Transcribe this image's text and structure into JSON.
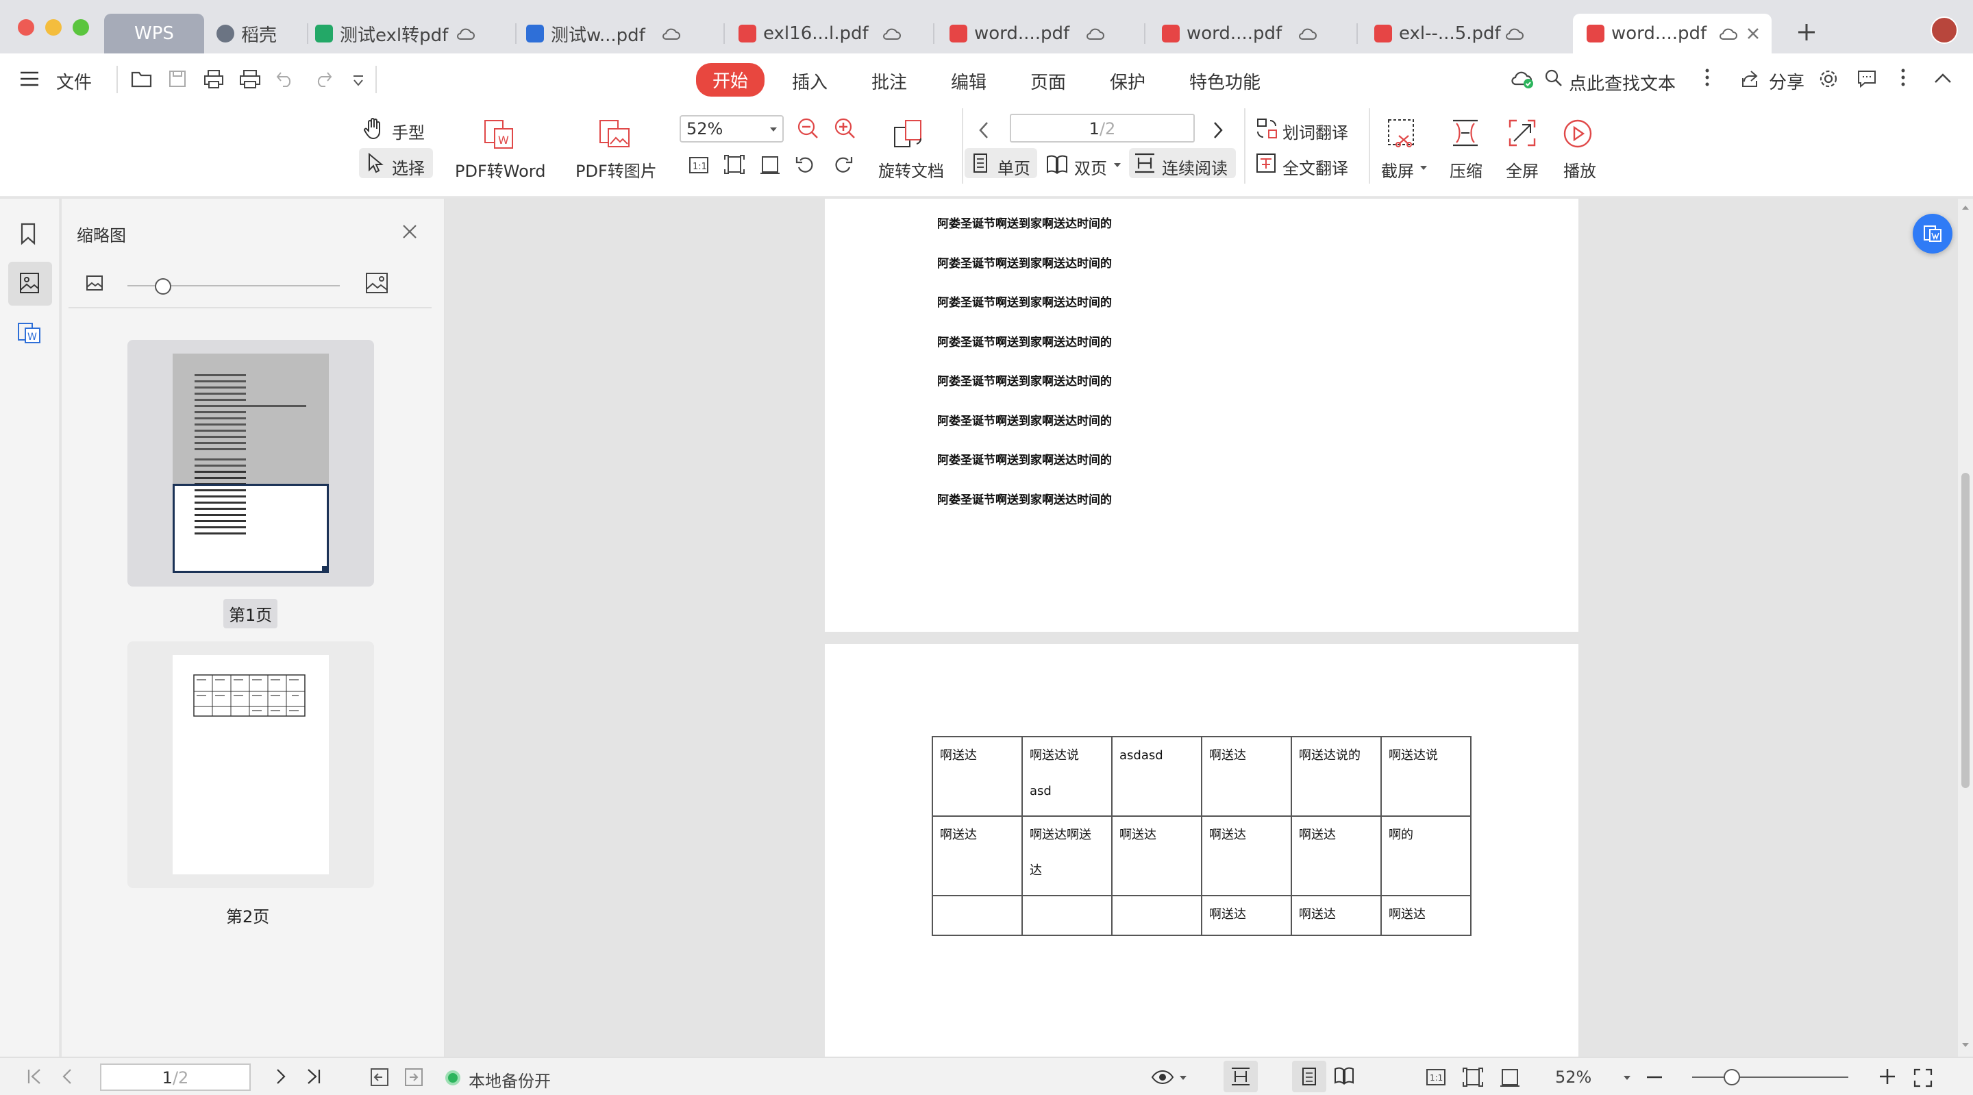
{
  "tabs": [
    {
      "label": "WPS"
    },
    {
      "label": "稻壳"
    },
    {
      "label": "测试exl转pdf"
    },
    {
      "label": "测试w...pdf"
    },
    {
      "label": "exl16...l.pdf"
    },
    {
      "label": "word....pdf"
    },
    {
      "label": "word....pdf"
    },
    {
      "label": "exl--...5.pdf"
    },
    {
      "label": "word....pdf"
    }
  ],
  "menu": {
    "file": "文件",
    "items": [
      "开始",
      "插入",
      "批注",
      "编辑",
      "页面",
      "保护",
      "特色功能"
    ],
    "search": "点此查找文本",
    "share": "分享"
  },
  "ribbon": {
    "hand": "手型",
    "select": "选择",
    "pdf_to_word": "PDF转Word",
    "pdf_to_image": "PDF转图片",
    "zoom": "52%",
    "rotate": "旋转文档",
    "page_input": "1",
    "page_total": "/2",
    "single": "单页",
    "double": "双页",
    "continuous": "连续阅读",
    "word_translate": "划词翻译",
    "full_translate": "全文翻译",
    "screenshot": "截屏",
    "compress": "压缩",
    "fullscreen": "全屏",
    "play": "播放"
  },
  "thumbs": {
    "title": "缩略图",
    "page1": "第1页",
    "page2": "第2页"
  },
  "doc": {
    "page1_lines": [
      "阿娄圣诞节啊送到家啊送达时间的",
      "阿娄圣诞节啊送到家啊送达时间的",
      "阿娄圣诞节啊送到家啊送达时间的",
      "阿娄圣诞节啊送到家啊送达时间的",
      "阿娄圣诞节啊送到家啊送达时间的",
      "阿娄圣诞节啊送到家啊送达时间的",
      "阿娄圣诞节啊送到家啊送达时间的",
      "阿娄圣诞节啊送到家啊送达时间的"
    ],
    "table": [
      [
        [
          "啊送达"
        ],
        [
          "啊送达说",
          "asd"
        ],
        [
          "asdasd"
        ],
        [
          "啊送达"
        ],
        [
          "啊送达说的"
        ],
        [
          "啊送达说"
        ]
      ],
      [
        [
          "啊送达"
        ],
        [
          "啊送达啊送",
          "达"
        ],
        [
          "啊送达"
        ],
        [
          "啊送达"
        ],
        [
          "啊送达"
        ],
        [
          " 啊的"
        ]
      ],
      [
        [
          ""
        ],
        [
          ""
        ],
        [
          ""
        ],
        [
          "啊送达"
        ],
        [
          "啊送达"
        ],
        [
          "啊送达"
        ]
      ]
    ]
  },
  "status": {
    "page_input": "1",
    "page_total": "/2",
    "backup": "本地备份开",
    "zoom": "52%"
  },
  "colors": {
    "accent_red": "#e8473f",
    "tab_active": "#ffffff",
    "tab_bar": "#e2e3e7",
    "wps_tab": "#a6abb8",
    "pdf_icon": "#e64545",
    "word_icon": "#2e6fd8",
    "sheet_icon": "#23a867",
    "blue_float": "#2f7bf6"
  }
}
